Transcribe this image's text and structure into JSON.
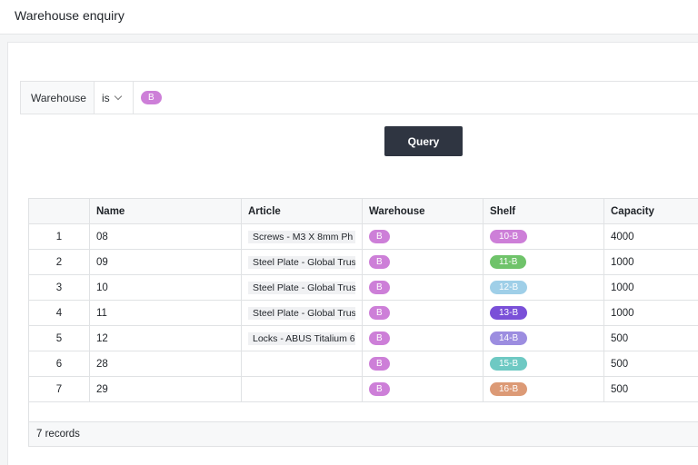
{
  "header": {
    "title": "Warehouse enquiry"
  },
  "filter": {
    "field": "Warehouse",
    "operator": "is",
    "value": "B",
    "value_color": "#cd7fd8"
  },
  "query_button": {
    "label": "Query"
  },
  "table": {
    "columns": [
      "",
      "Name",
      "Article",
      "Warehouse",
      "Shelf",
      "Capacity"
    ],
    "rows": [
      {
        "idx": "1",
        "name": "08",
        "article": "Screws - M3 X 8mm Ph",
        "warehouse": "B",
        "shelf": "10-B",
        "shelf_color": "#cd7fd8",
        "capacity": "4000"
      },
      {
        "idx": "2",
        "name": "09",
        "article": "Steel Plate - Global Trus",
        "warehouse": "B",
        "shelf": "11-B",
        "shelf_color": "#6fc36a",
        "capacity": "1000"
      },
      {
        "idx": "3",
        "name": "10",
        "article": "Steel Plate - Global Trus",
        "warehouse": "B",
        "shelf": "12-B",
        "shelf_color": "#9fcfe8",
        "capacity": "1000"
      },
      {
        "idx": "4",
        "name": "11",
        "article": "Steel Plate - Global Trus",
        "warehouse": "B",
        "shelf": "13-B",
        "shelf_color": "#7a50d8",
        "capacity": "1000"
      },
      {
        "idx": "5",
        "name": "12",
        "article": "Locks - ABUS Titalium 6",
        "warehouse": "B",
        "shelf": "14-B",
        "shelf_color": "#9c8de0",
        "capacity": "500"
      },
      {
        "idx": "6",
        "name": "28",
        "article": "",
        "warehouse": "B",
        "shelf": "15-B",
        "shelf_color": "#6ec9c3",
        "capacity": "500"
      },
      {
        "idx": "7",
        "name": "29",
        "article": "",
        "warehouse": "B",
        "shelf": "16-B",
        "shelf_color": "#dc9a76",
        "capacity": "500"
      }
    ]
  },
  "footer": {
    "record_count": "7 records"
  },
  "colors": {
    "warehouse_tag": "#cd7fd8",
    "button_bg": "#2f3541"
  }
}
